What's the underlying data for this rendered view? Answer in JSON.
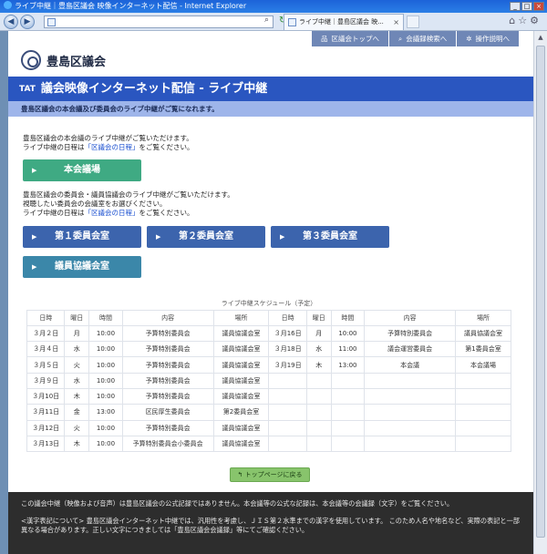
{
  "browser": {
    "title": "ライブ中継｜豊島区議会 映像インターネット配信 - Internet Explorer",
    "tab_label": "ライブ中継｜豊島区議会 映...",
    "address": ""
  },
  "topnav": [
    {
      "icon": "sitemap-icon",
      "label": "区議会トップへ"
    },
    {
      "icon": "search-icon",
      "label": "会議録検索へ"
    },
    {
      "icon": "gear-icon",
      "label": "操作説明へ"
    }
  ],
  "logo_text": "豊島区議会",
  "banner": {
    "icon_text": "TAT",
    "title": "議会映像インターネット配信 - ライブ中継"
  },
  "subbanner": "豊島区議会の本会議及び委員会のライブ中継がご覧になれます。",
  "intro1": {
    "line1": "豊島区議会の本会議のライブ中継がご覧いただけます。",
    "line2_pre": "ライブ中継の日程は",
    "line2_link": "「区議会の日程」",
    "line2_post": "をご覧ください。"
  },
  "main_button": "本会議場",
  "intro2": {
    "line1": "豊島区議会の委員会・議員協議会のライブ中継がご覧いただけます。",
    "line2": "視聴したい委員会の会議室をお選びください。",
    "line3_pre": "ライブ中継の日程は",
    "line3_link": "「区議会の日程」",
    "line3_post": "をご覧ください。"
  },
  "rooms": [
    "第１委員会室",
    "第２委員会室",
    "第３委員会室",
    "議員協議会室"
  ],
  "schedule": {
    "caption": "ライブ中継スケジュール（予定）",
    "headers": [
      "日時",
      "曜日",
      "時間",
      "内容",
      "場所",
      "日時",
      "曜日",
      "時間",
      "内容",
      "場所"
    ],
    "rows": [
      [
        "３月２日",
        "月",
        "10:00",
        "予算特別委員会",
        "議員協議会室",
        "３月16日",
        "月",
        "10:00",
        "予算特別委員会",
        "議員協議会室"
      ],
      [
        "３月４日",
        "水",
        "10:00",
        "予算特別委員会",
        "議員協議会室",
        "３月18日",
        "水",
        "11:00",
        "議会運営委員会",
        "第1委員会室"
      ],
      [
        "３月５日",
        "火",
        "10:00",
        "予算特別委員会",
        "議員協議会室",
        "３月19日",
        "木",
        "13:00",
        "本会議",
        "本会議場"
      ],
      [
        "３月９日",
        "水",
        "10:00",
        "予算特別委員会",
        "議員協議会室",
        "",
        "",
        "",
        "",
        ""
      ],
      [
        "３月10日",
        "木",
        "10:00",
        "予算特別委員会",
        "議員協議会室",
        "",
        "",
        "",
        "",
        ""
      ],
      [
        "３月11日",
        "金",
        "13:00",
        "区民厚生委員会",
        "第2委員会室",
        "",
        "",
        "",
        "",
        ""
      ],
      [
        "３月12日",
        "火",
        "10:00",
        "予算特別委員会",
        "議員協議会室",
        "",
        "",
        "",
        "",
        ""
      ],
      [
        "３月13日",
        "木",
        "10:00",
        "予算特別委員会小委員会",
        "議員協議会室",
        "",
        "",
        "",
        "",
        ""
      ]
    ]
  },
  "top_button": "トップページに戻る",
  "footer": {
    "line1": "この議会中継（映像および音声）は豊島区議会の公式記録ではありません。本会議等の公式な記録は、本会議等の会議録（文字）をご覧ください。",
    "line2": "<漢字表記について> 豊島区議会インターネット中継では、汎用性を考慮し、ＪＩＳ第２水準までの漢字を使用しています。 このため人名や地名など、実際の表記と一部異なる場合があります。正しい文字につきましては「豊島区議会会議録」等にてご確認ください。"
  }
}
